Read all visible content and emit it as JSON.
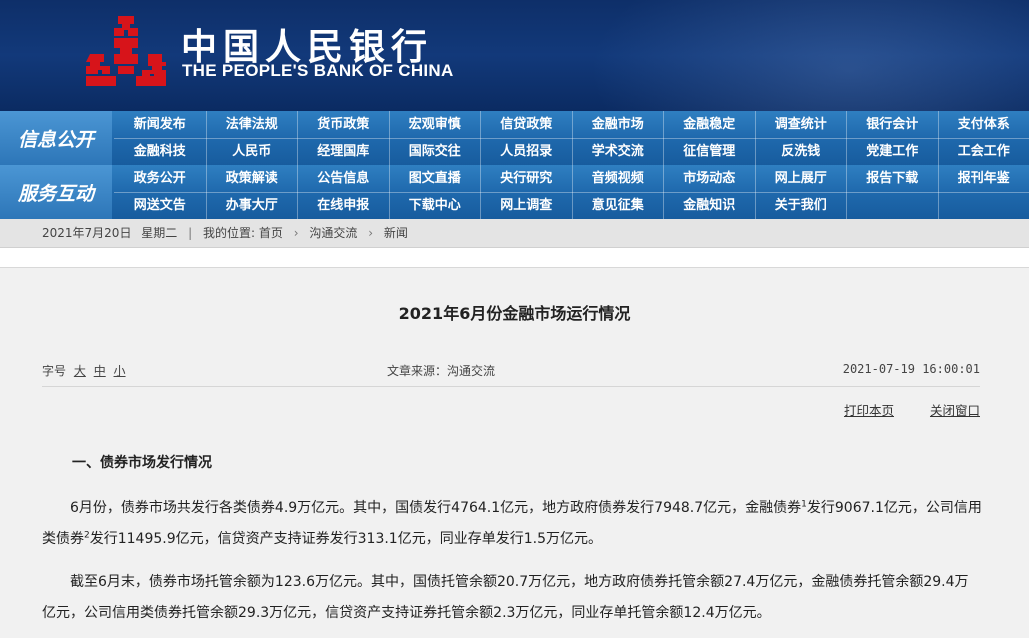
{
  "header": {
    "bank_name_cn": "中国人民银行",
    "bank_name_en": "THE PEOPLE'S BANK OF CHINA",
    "emblem_color": "#d7141a",
    "background_color": "#0e2f69"
  },
  "nav": {
    "info_label": "信息公开",
    "info_row1": [
      "新闻发布",
      "法律法规",
      "货币政策",
      "宏观审慎",
      "信贷政策",
      "金融市场",
      "金融稳定",
      "调查统计",
      "银行会计",
      "支付体系"
    ],
    "info_row2": [
      "金融科技",
      "人民币",
      "经理国库",
      "国际交往",
      "人员招录",
      "学术交流",
      "征信管理",
      "反洗钱",
      "党建工作",
      "工会工作"
    ],
    "service_label": "服务互动",
    "service_row1": [
      "政务公开",
      "政策解读",
      "公告信息",
      "图文直播",
      "央行研究",
      "音频视频",
      "市场动态",
      "网上展厅",
      "报告下载",
      "报刊年鉴"
    ],
    "service_row2": [
      "网送文告",
      "办事大厅",
      "在线申报",
      "下载中心",
      "网上调查",
      "意见征集",
      "金融知识",
      "关于我们"
    ],
    "accent_color": "#1f69ad"
  },
  "breadcrumb": {
    "date": "2021年7月20日",
    "weekday": "星期二",
    "location_label": "我的位置:",
    "items": [
      "首页",
      "沟通交流",
      "新闻"
    ]
  },
  "article": {
    "title": "2021年6月份金融市场运行情况",
    "font_size_label": "字号",
    "font_sizes": [
      "大",
      "中",
      "小"
    ],
    "source": "文章来源：沟通交流",
    "datetime": "2021-07-19 16:00:01",
    "print_label": "打印本页",
    "close_label": "关闭窗口",
    "section1_heading": "一、债券市场发行情况",
    "para1": {
      "a": "6月份，债券市场共发行各类债券4.9万亿元。其中，国债发行4764.1亿元，地方政府债券发行7948.7亿元，金融债券",
      "sup1": "1",
      "b": "发行9067.1亿元，公司信用类债券",
      "sup2": "2",
      "c": "发行11495.9亿元，信贷资产支持证券发行313.1亿元，同业存单发行1.5万亿元。"
    },
    "para2": "截至6月末，债券市场托管余额为123.6万亿元。其中，国债托管余额20.7万亿元，地方政府债券托管余额27.4万亿元，金融债券托管余额29.4万亿元，公司信用类债券托管余额29.3万亿元，信贷资产支持证券托管余额2.3万亿元，同业存单托管余额12.4万亿元。"
  }
}
